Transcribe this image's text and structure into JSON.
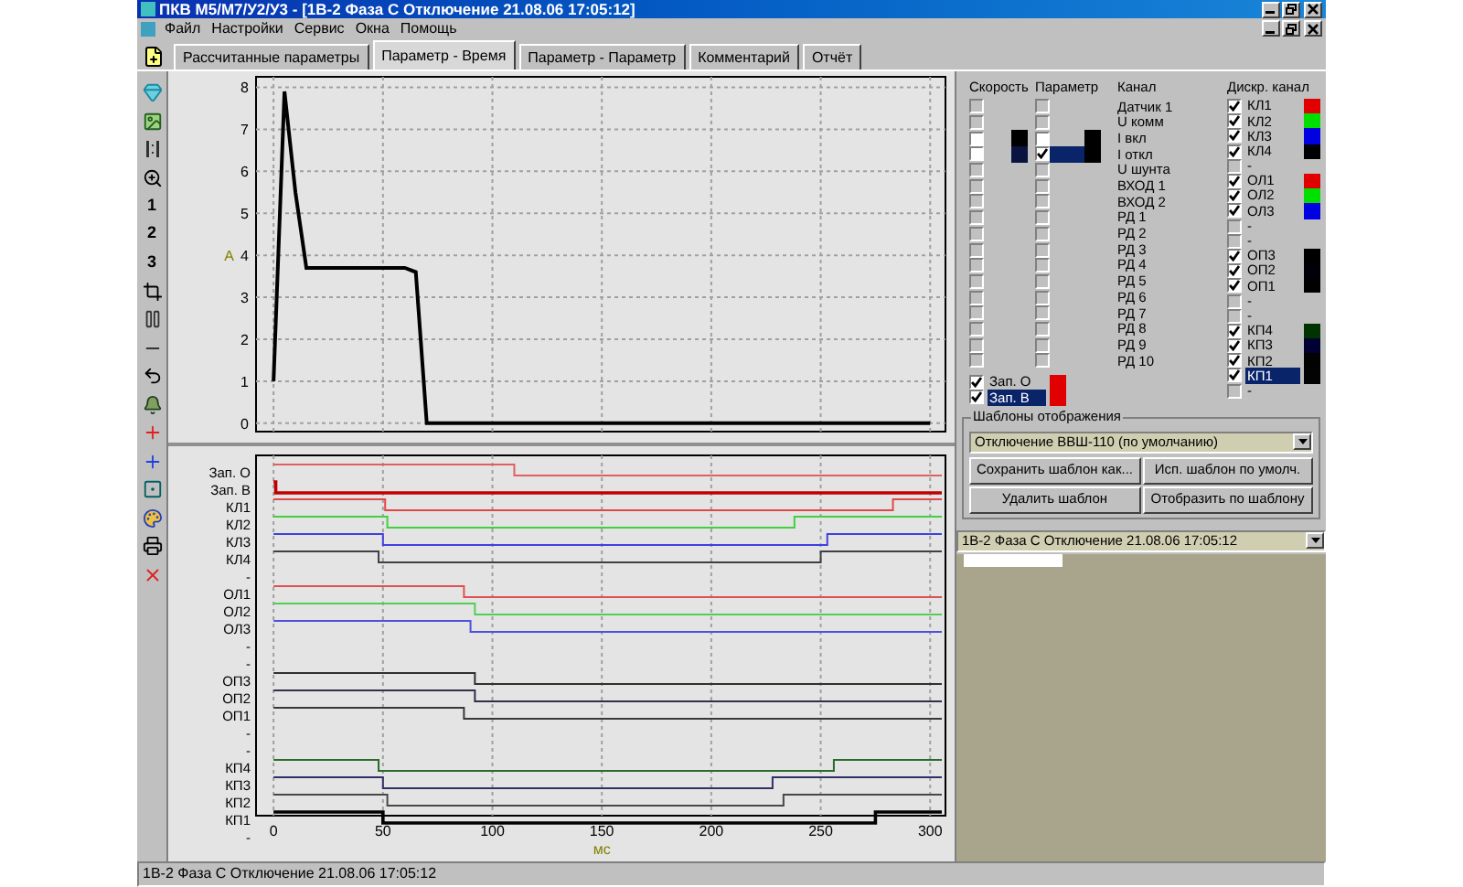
{
  "window": {
    "title": "ПКВ М5/М7/У2/У3 - [1В-2 Фаза С Отключение 21.08.06 17:05:12]"
  },
  "menu": [
    "Файл",
    "Настройки",
    "Сервис",
    "Окна",
    "Помощь"
  ],
  "tabs": [
    {
      "label": "Рассчитанные параметры",
      "selected": false
    },
    {
      "label": "Параметр - Время",
      "selected": true
    },
    {
      "label": "Параметр - Параметр",
      "selected": false
    },
    {
      "label": "Комментарий",
      "selected": false
    },
    {
      "label": "Отчёт",
      "selected": false
    }
  ],
  "toolbar": [
    {
      "kind": "gem"
    },
    {
      "kind": "image"
    },
    {
      "kind": "bars"
    },
    {
      "kind": "zoom"
    },
    {
      "kind": "text",
      "label": "1"
    },
    {
      "kind": "text",
      "label": "2"
    },
    {
      "kind": "text",
      "label": "3"
    },
    {
      "kind": "crop"
    },
    {
      "kind": "pause"
    },
    {
      "kind": "minus"
    },
    {
      "kind": "undo"
    },
    {
      "kind": "bell"
    },
    {
      "kind": "redplus"
    },
    {
      "kind": "blueplus"
    },
    {
      "kind": "frame"
    },
    {
      "kind": "palette"
    },
    {
      "kind": "printer"
    },
    {
      "kind": "delete"
    }
  ],
  "analog_chart": {
    "chart_data": {
      "type": "line",
      "grid": true,
      "ylabel": "А",
      "ylim": [
        -0.2,
        8.25
      ],
      "yticks": [
        0,
        1,
        2,
        3,
        4,
        5,
        6,
        7,
        8
      ],
      "categories": [
        null,
        null,
        null,
        null,
        null,
        null,
        null,
        null,
        null,
        null,
        null,
        null,
        null,
        null,
        null,
        null,
        null,
        null,
        null,
        null,
        null,
        null,
        null,
        null,
        null,
        null,
        null,
        null,
        null,
        null,
        null,
        null,
        null,
        null,
        null,
        null,
        null,
        null,
        null,
        null,
        null,
        null,
        null,
        null,
        null,
        null,
        null,
        null,
        null,
        null,
        null,
        null,
        null,
        null,
        null,
        null,
        null,
        null,
        null,
        null,
        null
      ],
      "series": [
        {
          "color": "#000000",
          "values": [
            1,
            7.9,
            5.5,
            3.7,
            3.7,
            3.7,
            3.7,
            3.7,
            3.7,
            3.7,
            3.7,
            3.7,
            3.7,
            3.6,
            0,
            0,
            0,
            0,
            0,
            0,
            0,
            0,
            0,
            0,
            0,
            0,
            0,
            0,
            0,
            0,
            0,
            0,
            0,
            0,
            0,
            0,
            0,
            0,
            0,
            0,
            0,
            0,
            0,
            0,
            0,
            0,
            0,
            0,
            0,
            0,
            0,
            0,
            0,
            0,
            0,
            0,
            0,
            0,
            0,
            0,
            0
          ]
        }
      ]
    }
  },
  "digital_chart": {
    "x_ticks": [
      "0",
      "50",
      "100",
      "150",
      "200",
      "250",
      "300"
    ],
    "x_label": "мс",
    "channels": [
      {
        "label": "Зап. О",
        "color": "#e06060"
      },
      {
        "label": "Зап. В",
        "color": "#c00000"
      },
      {
        "label": "КЛ1",
        "color": "#e04848"
      },
      {
        "label": "КЛ2",
        "color": "#40d040"
      },
      {
        "label": "КЛ3",
        "color": "#4040e0"
      },
      {
        "label": "КЛ4",
        "color": "#404040"
      },
      {
        "label": "-"
      },
      {
        "label": "ОЛ1",
        "color": "#e05050"
      },
      {
        "label": "ОЛ2",
        "color": "#50d050"
      },
      {
        "label": "ОЛ3",
        "color": "#5050e0"
      },
      {
        "label": "-"
      },
      {
        "label": "-"
      },
      {
        "label": "ОП3",
        "color": "#303030"
      },
      {
        "label": "ОП2",
        "color": "#303048"
      },
      {
        "label": "ОП1",
        "color": "#383838"
      },
      {
        "label": "-"
      },
      {
        "label": "-"
      },
      {
        "label": "КП4",
        "color": "#2a6a2a"
      },
      {
        "label": "КП3",
        "color": "#30306a"
      },
      {
        "label": "КП2",
        "color": "#484848"
      },
      {
        "label": "КП1",
        "color": "#000000"
      },
      {
        "label": "-"
      }
    ]
  },
  "channel_panel": {
    "headers": {
      "speed": "Скорость",
      "param": "Параметр",
      "channel": "Канал",
      "discrete": "Дискр. канал"
    },
    "analog_channels": [
      {
        "label": "Датчик 1",
        "speed": {
          "disabled": true,
          "checked": false
        },
        "param": {
          "disabled": true,
          "checked": false,
          "selected": false
        }
      },
      {
        "label": "U комм",
        "speed": {
          "disabled": true,
          "checked": false
        },
        "param": {
          "disabled": true,
          "checked": false,
          "selected": false
        }
      },
      {
        "label": "I вкл",
        "speed": {
          "disabled": false,
          "checked": false,
          "color": "#000000"
        },
        "param": {
          "disabled": false,
          "checked": false,
          "selected": false,
          "color": "#000000"
        }
      },
      {
        "label": "I откл",
        "speed": {
          "disabled": false,
          "checked": false,
          "color": "#0a1440"
        },
        "param": {
          "disabled": false,
          "checked": true,
          "selected": true,
          "color": "#000000"
        }
      },
      {
        "label": "U шунта",
        "speed": {
          "disabled": true,
          "checked": false
        },
        "param": {
          "disabled": true,
          "checked": false,
          "selected": false
        }
      },
      {
        "label": "ВХОД 1",
        "speed": {
          "disabled": true,
          "checked": false
        },
        "param": {
          "disabled": true,
          "checked": false,
          "selected": false
        }
      },
      {
        "label": "ВХОД 2",
        "speed": {
          "disabled": true,
          "checked": false
        },
        "param": {
          "disabled": true,
          "checked": false,
          "selected": false
        }
      },
      {
        "label": "РД 1",
        "speed": {
          "disabled": true,
          "checked": false
        },
        "param": {
          "disabled": true,
          "checked": false,
          "selected": false
        }
      },
      {
        "label": "РД 2",
        "speed": {
          "disabled": true,
          "checked": false
        },
        "param": {
          "disabled": true,
          "checked": false,
          "selected": false
        }
      },
      {
        "label": "РД 3",
        "speed": {
          "disabled": true,
          "checked": false
        },
        "param": {
          "disabled": true,
          "checked": false,
          "selected": false
        }
      },
      {
        "label": "РД 4",
        "speed": {
          "disabled": true,
          "checked": false
        },
        "param": {
          "disabled": true,
          "checked": false,
          "selected": false
        }
      },
      {
        "label": "РД 5",
        "speed": {
          "disabled": true,
          "checked": false
        },
        "param": {
          "disabled": true,
          "checked": false,
          "selected": false
        }
      },
      {
        "label": "РД 6",
        "speed": {
          "disabled": true,
          "checked": false
        },
        "param": {
          "disabled": true,
          "checked": false,
          "selected": false
        }
      },
      {
        "label": "РД 7",
        "speed": {
          "disabled": true,
          "checked": false
        },
        "param": {
          "disabled": true,
          "checked": false,
          "selected": false
        }
      },
      {
        "label": "РД 8",
        "speed": {
          "disabled": true,
          "checked": false
        },
        "param": {
          "disabled": true,
          "checked": false,
          "selected": false
        }
      },
      {
        "label": "РД 9",
        "speed": {
          "disabled": true,
          "checked": false
        },
        "param": {
          "disabled": true,
          "checked": false,
          "selected": false
        }
      },
      {
        "label": "РД 10",
        "speed": {
          "disabled": true,
          "checked": false
        },
        "param": {
          "disabled": true,
          "checked": false,
          "selected": false
        }
      }
    ],
    "zap_channels": [
      {
        "label": "Зап. О",
        "checked": true,
        "selected": false,
        "color": "#e00000"
      },
      {
        "label": "Зап. В",
        "checked": true,
        "selected": true,
        "color": "#e00000"
      }
    ],
    "discrete_channels": [
      {
        "label": "КЛ1",
        "checked": true,
        "selected": false,
        "color": "#e00000"
      },
      {
        "label": "КЛ2",
        "checked": true,
        "selected": false,
        "color": "#00e000"
      },
      {
        "label": "КЛ3",
        "checked": true,
        "selected": false,
        "color": "#0000e0"
      },
      {
        "label": "КЛ4",
        "checked": true,
        "selected": false,
        "color": "#000000"
      },
      {
        "label": "-",
        "checked": false,
        "selected": false
      },
      {
        "label": "ОЛ1",
        "checked": true,
        "selected": false,
        "color": "#e00000"
      },
      {
        "label": "ОЛ2",
        "checked": true,
        "selected": false,
        "color": "#00e000"
      },
      {
        "label": "ОЛ3",
        "checked": true,
        "selected": false,
        "color": "#0000e0"
      },
      {
        "label": "-",
        "checked": false,
        "selected": false
      },
      {
        "label": "-",
        "checked": false,
        "selected": false
      },
      {
        "label": "ОП3",
        "checked": true,
        "selected": false,
        "color": "#000000"
      },
      {
        "label": "ОП2",
        "checked": true,
        "selected": false,
        "color": "#000008"
      },
      {
        "label": "ОП1",
        "checked": true,
        "selected": false,
        "color": "#010101"
      },
      {
        "label": "-",
        "checked": false,
        "selected": false
      },
      {
        "label": "-",
        "checked": false,
        "selected": false
      },
      {
        "label": "КП4",
        "checked": true,
        "selected": false,
        "color": "#003300"
      },
      {
        "label": "КП3",
        "checked": true,
        "selected": false,
        "color": "#000033"
      },
      {
        "label": "КП2",
        "checked": true,
        "selected": false,
        "color": "#020202"
      },
      {
        "label": "КП1",
        "checked": true,
        "selected": true,
        "color": "#030303"
      },
      {
        "label": "-",
        "checked": false,
        "selected": false
      }
    ]
  },
  "templates": {
    "title": "Шаблоны отображения",
    "value": "Отключение ВВШ-110 (по умолчанию)",
    "buttons": [
      "Сохранить шаблон как...",
      "Исп. шаблон по умолч.",
      "Удалить шаблон",
      "Отобразить по шаблону"
    ]
  },
  "record_select": {
    "value": "1В-2 Фаза С Отключение 21.08.06 17:05:12"
  },
  "status_bar": "1В-2 Фаза С Отключение 21.08.06 17:05:12"
}
